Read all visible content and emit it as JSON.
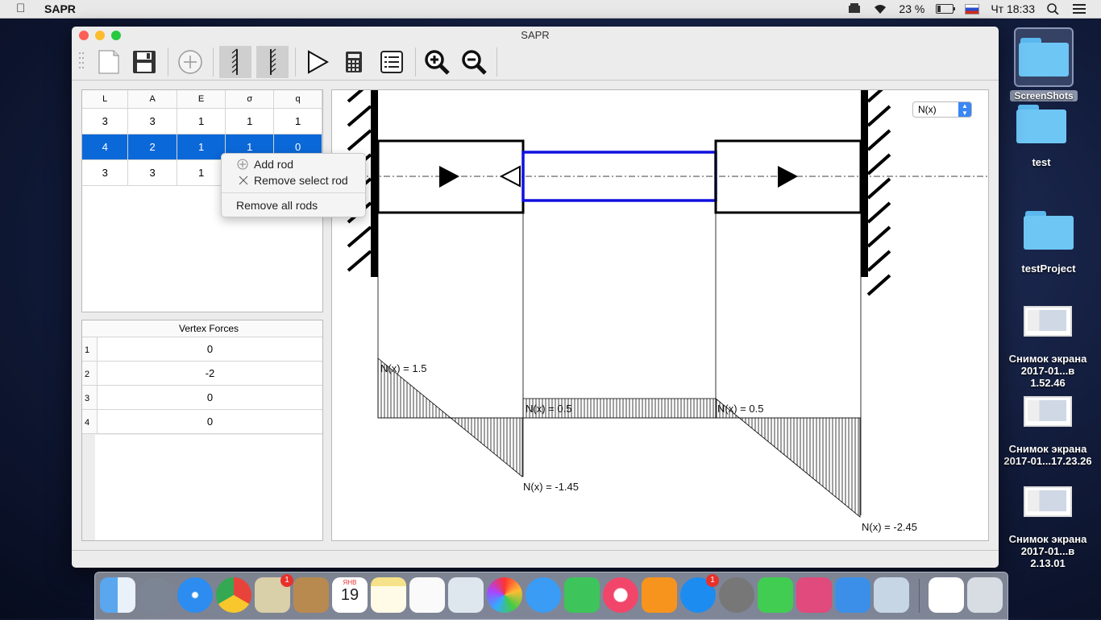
{
  "menubar": {
    "app": "SAPR",
    "battery": "23 %",
    "clock": "Чт 18:33"
  },
  "window": {
    "title": "SAPR"
  },
  "toolbar": {
    "items": [
      "new-file",
      "save",
      "add-rod",
      "left-support",
      "right-support",
      "run",
      "calculator",
      "list",
      "zoom-in",
      "zoom-out"
    ]
  },
  "rods_table": {
    "headers": [
      "L",
      "A",
      "E",
      "σ",
      "q"
    ],
    "rows": [
      [
        "3",
        "3",
        "1",
        "1",
        "1"
      ],
      [
        "4",
        "2",
        "1",
        "1",
        "0"
      ],
      [
        "3",
        "3",
        "1",
        "",
        ""
      ]
    ],
    "selected_row": 1
  },
  "context_menu": {
    "add": "Add rod",
    "remove_selected": "Remove select rod",
    "remove_all": "Remove all rods"
  },
  "vertex_forces": {
    "header": "Vertex Forces",
    "rows": [
      {
        "index": "1",
        "value": "0"
      },
      {
        "index": "2",
        "value": "-2"
      },
      {
        "index": "3",
        "value": "0"
      },
      {
        "index": "4",
        "value": "0"
      }
    ]
  },
  "diagram": {
    "selector": "N(x)",
    "labels": [
      "N(x) = 1.5",
      "N(x) = 0.5",
      "N(x) = 0.5",
      "N(x) = -1.45",
      "N(x) = -2.45"
    ],
    "colors": {
      "middle_rod": "#1010e0",
      "rods": "#000000"
    }
  },
  "desktop": {
    "items": [
      {
        "label": "ScreenShots"
      },
      {
        "label": "test"
      },
      {
        "label": "testProject"
      },
      {
        "label1": "Снимок экрана",
        "label2": "2017-01...в 1.52.46"
      },
      {
        "label1": "Снимок экрана",
        "label2": "2017-01...17.23.26"
      },
      {
        "label1": "Снимок экрана",
        "label2": "2017-01...в 2.13.01"
      }
    ]
  },
  "dock": {
    "badges": {
      "mail": "1",
      "appstore": "1"
    },
    "calendar": {
      "month": "ЯНВ",
      "day": "19"
    }
  }
}
